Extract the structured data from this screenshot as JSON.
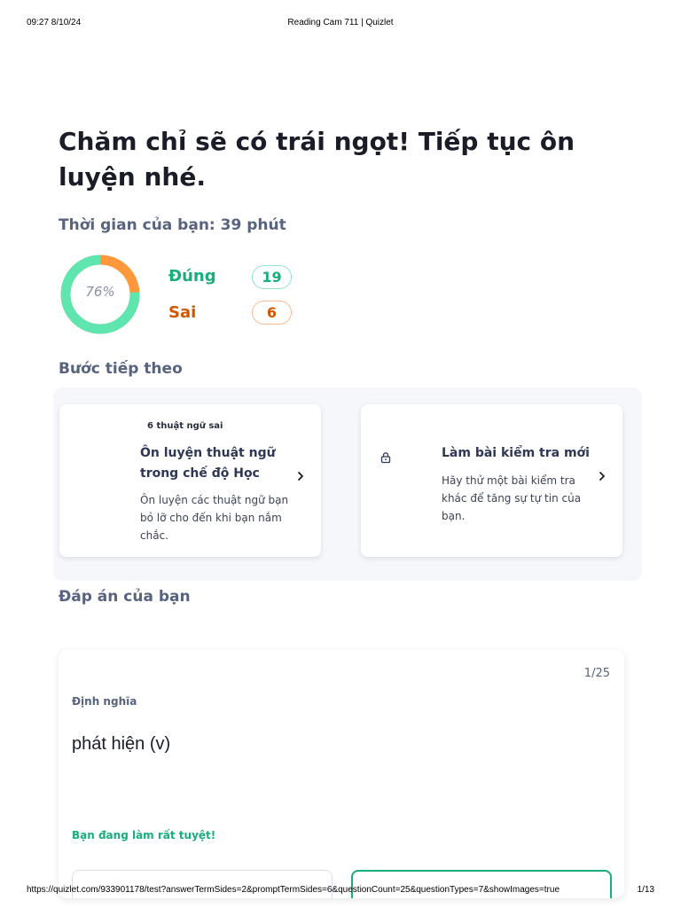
{
  "print_header": {
    "datetime": "09:27 8/10/24",
    "title": "Reading Cam 711 | Quizlet"
  },
  "print_footer": {
    "url": "https://quizlet.com/933901178/test?answerTermSides=2&promptTermSides=6&questionCount=25&questionTypes=7&showImages=true",
    "page": "1/13"
  },
  "result": {
    "headline": "Chăm chỉ sẽ có trái ngọt! Tiếp tục ôn luyện nhé.",
    "time_text": "Thời gian của bạn: 39 phút",
    "percent_label": "76%",
    "percent_value": 0.76,
    "correct_label": "Đúng",
    "correct_count": "19",
    "wrong_label": "Sai",
    "wrong_count": "6",
    "colors": {
      "correct": "#18ae79",
      "ring_correct": "#5ee5b0",
      "wrong": "#d05700",
      "ring_wrong": "#ff983a"
    }
  },
  "next_steps": {
    "heading": "Bước tiếp theo",
    "cards": [
      {
        "chip": "6 thuật ngữ sai",
        "title": "Ôn luyện thuật ngữ trong chế độ Học",
        "description": "Ôn luyện các thuật ngữ bạn bỏ lỡ cho đến khi bạn nắm chắc.",
        "icon": "chevron-right-icon"
      },
      {
        "title": "Làm bài kiểm tra mới",
        "description": "Hãy thử một bài kiểm tra khác để tăng sự tự tin của bạn.",
        "icon": "lock-icon"
      }
    ]
  },
  "answers": {
    "heading": "Đáp án của bạn",
    "counter": "1/25",
    "term_type": "Định nghĩa",
    "term": "phát hiện (v)",
    "feedback": "Bạn đang làm rất tuyệt!"
  }
}
